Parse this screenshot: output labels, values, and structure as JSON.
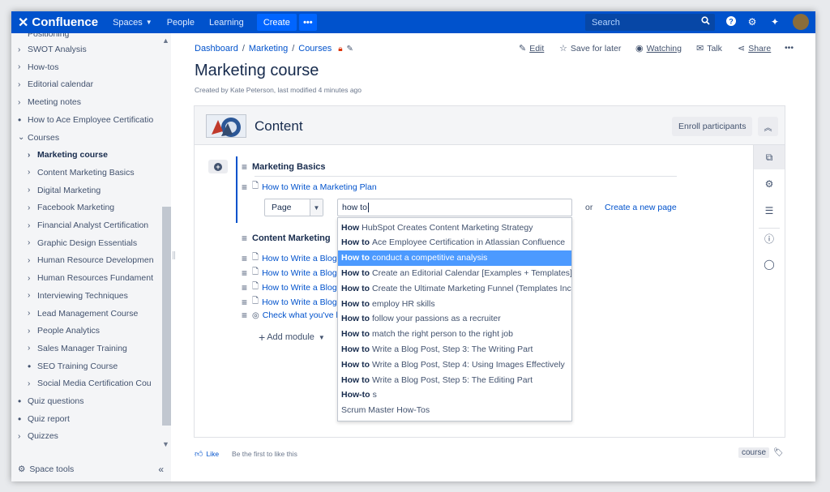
{
  "topbar": {
    "product": "Confluence",
    "nav": [
      "Spaces",
      "People",
      "Learning"
    ],
    "create_label": "Create",
    "more_label": "•••",
    "search_placeholder": "Search",
    "accent": "#0052cc"
  },
  "sidebar": {
    "partial_top": "Positioning",
    "items": [
      {
        "label": "SWOT Analysis",
        "marker": "chevron"
      },
      {
        "label": "How-tos",
        "marker": "chevron"
      },
      {
        "label": "Editorial calendar",
        "marker": "chevron"
      },
      {
        "label": "Meeting notes",
        "marker": "chevron"
      },
      {
        "label": "How to Ace Employee Certificatio",
        "marker": "dot"
      },
      {
        "label": "Courses",
        "marker": "expanded"
      },
      {
        "label": "Marketing course",
        "marker": "chevron",
        "child": true,
        "active": true
      },
      {
        "label": "Content Marketing Basics",
        "marker": "chevron",
        "child": true
      },
      {
        "label": "Digital Marketing",
        "marker": "chevron",
        "child": true
      },
      {
        "label": "Facebook Marketing",
        "marker": "chevron",
        "child": true
      },
      {
        "label": "Financial Analyst Certification",
        "marker": "chevron",
        "child": true
      },
      {
        "label": "Graphic Design Essentials",
        "marker": "chevron",
        "child": true
      },
      {
        "label": "Human Resource Developmen",
        "marker": "chevron",
        "child": true
      },
      {
        "label": "Human Resources Fundament",
        "marker": "chevron",
        "child": true
      },
      {
        "label": "Interviewing Techniques",
        "marker": "chevron",
        "child": true
      },
      {
        "label": "Lead Management Course",
        "marker": "chevron",
        "child": true
      },
      {
        "label": "People Analytics",
        "marker": "chevron",
        "child": true
      },
      {
        "label": "Sales Manager Training",
        "marker": "chevron",
        "child": true
      },
      {
        "label": "SEO Training Course",
        "marker": "dot",
        "child": true
      },
      {
        "label": "Social Media Certification Cou",
        "marker": "chevron",
        "child": true
      },
      {
        "label": "Quiz questions",
        "marker": "dot"
      },
      {
        "label": "Quiz report",
        "marker": "dot"
      },
      {
        "label": "Quizzes",
        "marker": "chevron"
      }
    ],
    "space_tools": "Space tools"
  },
  "breadcrumb": [
    "Dashboard",
    "Marketing",
    "Courses"
  ],
  "page_actions": {
    "edit": "Edit",
    "save_later": "Save for later",
    "watching": "Watching",
    "talk": "Talk",
    "share": "Share",
    "more": "•••"
  },
  "page": {
    "title": "Marketing course",
    "byline": "Created by Kate Peterson, last modified 4 minutes ago"
  },
  "panel": {
    "title": "Content",
    "enroll": "Enroll participants"
  },
  "modules": {
    "section1": "Marketing Basics",
    "lesson1": "How to Write a Marketing Plan",
    "section2": "Content Marketing",
    "lessons2": [
      "How to Write a Blog",
      "How to Write a Blog",
      "How to Write a Blog",
      "How to Write a Blog"
    ],
    "check": "Check what you've le",
    "add_module": "Add module"
  },
  "picker": {
    "type": "Page",
    "query": "how to",
    "or": "or",
    "create_new": "Create a new page"
  },
  "suggestions": [
    {
      "bold": "How",
      "rest": "HubSpot Creates Content Marketing Strategy"
    },
    {
      "bold": "How to",
      "rest": "Ace Employee Certification in Atlassian Confluence"
    },
    {
      "bold": "How to",
      "rest": "conduct a competitive analysis",
      "selected": true
    },
    {
      "bold": "How to",
      "rest": "Create an Editorial Calendar [Examples + Templates]"
    },
    {
      "bold": "How to",
      "rest": "Create the Ultimate Marketing Funnel (Templates Incl..."
    },
    {
      "bold": "How to",
      "rest": "employ HR skills"
    },
    {
      "bold": "How to",
      "rest": "follow your passions as a recruiter"
    },
    {
      "bold": "How to",
      "rest": "match the right person to the right job"
    },
    {
      "bold": "How to",
      "rest": "Write a Blog Post, Step 3: The Writing Part"
    },
    {
      "bold": "How to",
      "rest": "Write a Blog Post, Step 4: Using Images Effectively"
    },
    {
      "bold": "How to",
      "rest": "Write a Blog Post, Step 5: The Editing Part"
    },
    {
      "bold": "How-to",
      "rest": "s"
    },
    {
      "bold": "",
      "rest": "Scrum Master How-Tos"
    }
  ],
  "footer": {
    "like": "Like",
    "first_like": "Be the first to like this",
    "tag": "course"
  }
}
